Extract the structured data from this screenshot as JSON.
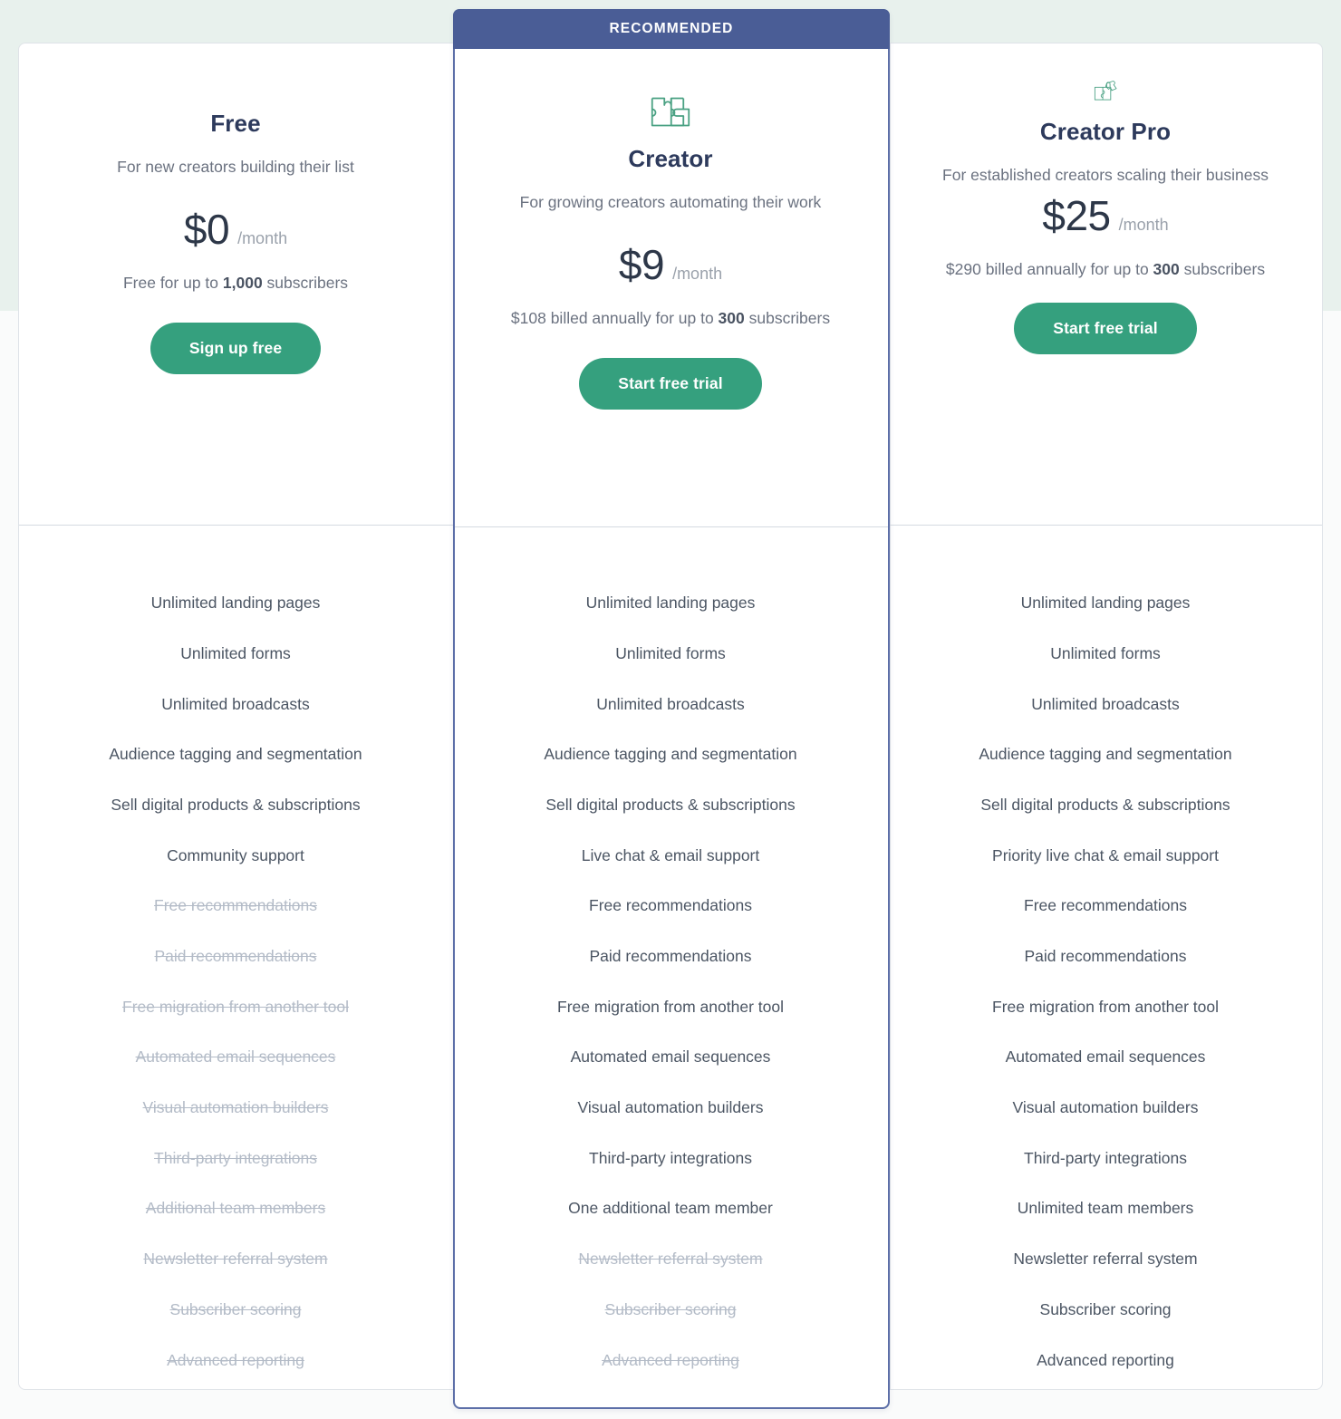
{
  "ribbon": {
    "label": "RECOMMENDED"
  },
  "colors": {
    "accent_green": "#35a07e",
    "recommended_blue": "#4a5d96",
    "recommended_border": "#5d6fa8",
    "heading_navy": "#2d3a5c",
    "body_gray": "#6b7280",
    "excluded_gray": "#b3bbc7",
    "background_mint": "#e8f1ed"
  },
  "plans": [
    {
      "id": "free",
      "icon": "puzzle-two-pieces-icon",
      "name": "Free",
      "description": "For new creators building their list",
      "price_amount": "$0",
      "price_period": "/month",
      "billing_note_prefix": "Free for up to ",
      "billing_note_bold": "1,000",
      "billing_note_suffix": " subscribers",
      "cta_label": "Sign up free",
      "features": [
        {
          "label": "Unlimited landing pages",
          "included": true
        },
        {
          "label": "Unlimited forms",
          "included": true
        },
        {
          "label": "Unlimited broadcasts",
          "included": true
        },
        {
          "label": "Audience tagging and segmentation",
          "included": true
        },
        {
          "label": "Sell digital products & subscriptions",
          "included": true
        },
        {
          "label": "Community support",
          "included": true
        },
        {
          "label": "Free recommendations",
          "included": false
        },
        {
          "label": "Paid recommendations",
          "included": false
        },
        {
          "label": "Free migration from another tool",
          "included": false
        },
        {
          "label": "Automated email sequences",
          "included": false
        },
        {
          "label": "Visual automation builders",
          "included": false
        },
        {
          "label": "Third-party integrations",
          "included": false
        },
        {
          "label": "Additional team members",
          "included": false
        },
        {
          "label": "Newsletter referral system",
          "included": false
        },
        {
          "label": "Subscriber scoring",
          "included": false
        },
        {
          "label": "Advanced reporting",
          "included": false
        }
      ]
    },
    {
      "id": "creator",
      "icon": "puzzle-three-pieces-icon",
      "name": "Creator",
      "description": "For growing creators automating their work",
      "price_amount": "$9",
      "price_period": "/month",
      "billing_note_prefix": "$108 billed annually for up to ",
      "billing_note_bold": "300",
      "billing_note_suffix": " subscribers",
      "cta_label": "Start free trial",
      "features": [
        {
          "label": "Unlimited landing pages",
          "included": true
        },
        {
          "label": "Unlimited forms",
          "included": true
        },
        {
          "label": "Unlimited broadcasts",
          "included": true
        },
        {
          "label": "Audience tagging and segmentation",
          "included": true
        },
        {
          "label": "Sell digital products & subscriptions",
          "included": true
        },
        {
          "label": "Live chat & email support",
          "included": true
        },
        {
          "label": "Free recommendations",
          "included": true
        },
        {
          "label": "Paid recommendations",
          "included": true
        },
        {
          "label": "Free migration from another tool",
          "included": true
        },
        {
          "label": "Automated email sequences",
          "included": true
        },
        {
          "label": "Visual automation builders",
          "included": true
        },
        {
          "label": "Third-party integrations",
          "included": true
        },
        {
          "label": "One additional team member",
          "included": true
        },
        {
          "label": "Newsletter referral system",
          "included": false
        },
        {
          "label": "Subscriber scoring",
          "included": false
        },
        {
          "label": "Advanced reporting",
          "included": false
        }
      ]
    },
    {
      "id": "creator-pro",
      "icon": "puzzle-four-pieces-icon",
      "name": "Creator Pro",
      "description": "For established creators scaling their business",
      "price_amount": "$25",
      "price_period": "/month",
      "billing_note_prefix": "$290 billed annually for up to ",
      "billing_note_bold": "300",
      "billing_note_suffix": " subscribers",
      "cta_label": "Start free trial",
      "features": [
        {
          "label": "Unlimited landing pages",
          "included": true
        },
        {
          "label": "Unlimited forms",
          "included": true
        },
        {
          "label": "Unlimited broadcasts",
          "included": true
        },
        {
          "label": "Audience tagging and segmentation",
          "included": true
        },
        {
          "label": "Sell digital products & subscriptions",
          "included": true
        },
        {
          "label": "Priority live chat & email support",
          "included": true
        },
        {
          "label": "Free recommendations",
          "included": true
        },
        {
          "label": "Paid recommendations",
          "included": true
        },
        {
          "label": "Free migration from another tool",
          "included": true
        },
        {
          "label": "Automated email sequences",
          "included": true
        },
        {
          "label": "Visual automation builders",
          "included": true
        },
        {
          "label": "Third-party integrations",
          "included": true
        },
        {
          "label": "Unlimited team members",
          "included": true
        },
        {
          "label": "Newsletter referral system",
          "included": true
        },
        {
          "label": "Subscriber scoring",
          "included": true
        },
        {
          "label": "Advanced reporting",
          "included": true
        }
      ]
    }
  ]
}
